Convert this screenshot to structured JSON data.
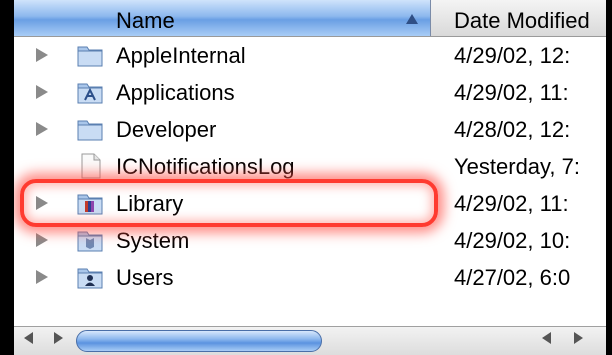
{
  "columns": {
    "name": "Name",
    "date_modified": "Date Modified"
  },
  "rows": [
    {
      "name": "AppleInternal",
      "date": "4/29/02, 12:",
      "icon": "folder-icon",
      "expandable": true
    },
    {
      "name": "Applications",
      "date": "4/29/02, 11:",
      "icon": "applications-folder-icon",
      "expandable": true
    },
    {
      "name": "Developer",
      "date": "4/28/02, 12:",
      "icon": "folder-icon",
      "expandable": true
    },
    {
      "name": "ICNotificationsLog",
      "date": "Yesterday, 7:",
      "icon": "document-icon",
      "expandable": false
    },
    {
      "name": "Library",
      "date": "4/29/02, 11:",
      "icon": "library-folder-icon",
      "expandable": true,
      "highlighted": true
    },
    {
      "name": "System",
      "date": "4/29/02, 10:",
      "icon": "system-folder-icon",
      "expandable": true
    },
    {
      "name": "Users",
      "date": "4/27/02, 6:0",
      "icon": "users-folder-icon",
      "expandable": true
    }
  ],
  "colors": {
    "highlight": "#ff3b30",
    "header_selected": "#8db8ee",
    "scroll_thumb": "#5b93e0"
  }
}
